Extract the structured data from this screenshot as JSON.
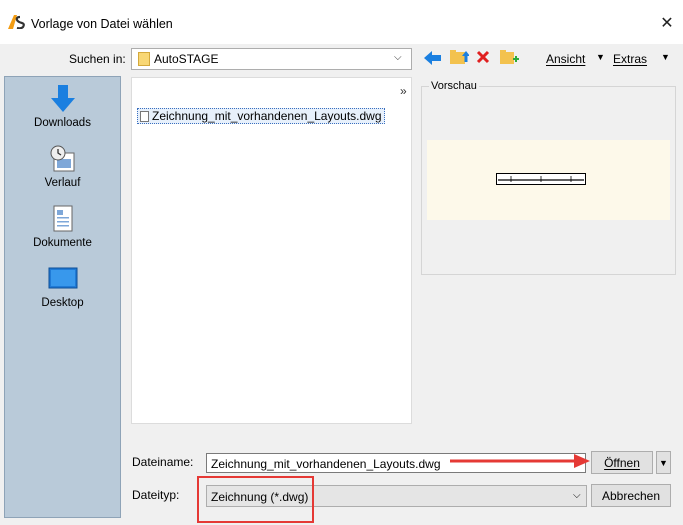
{
  "window": {
    "title": "Vorlage von Datei wählen",
    "logo_text": "AS",
    "close_glyph": "✕"
  },
  "toolbar": {
    "look_in_label": "Suchen in:",
    "look_in_value": "AutoSTAGE",
    "view_label": "Ansicht",
    "extras_label": "Extras"
  },
  "places": [
    {
      "label": "Downloads",
      "icon": "download-arrow-icon"
    },
    {
      "label": "Verlauf",
      "icon": "history-icon"
    },
    {
      "label": "Dokumente",
      "icon": "documents-icon"
    },
    {
      "label": "Desktop",
      "icon": "desktop-icon"
    }
  ],
  "file_list": {
    "items": [
      "Zeichnung_mit_vorhandenen_Layouts.dwg"
    ],
    "more_glyph": "»"
  },
  "preview": {
    "label": "Vorschau",
    "background_color": "#fdf9ea"
  },
  "form": {
    "filename_label": "Dateiname:",
    "filename_value": "Zeichnung_mit_vorhandenen_Layouts.dwg",
    "filetype_label": "Dateityp:",
    "filetype_value": "Zeichnung (*.dwg)",
    "open_button": "Öffnen",
    "cancel_button": "Abbrechen"
  },
  "colors": {
    "places_panel": "#b9cad9",
    "annotation_red": "#e53935",
    "accent_blue": "#1a7fe0"
  }
}
